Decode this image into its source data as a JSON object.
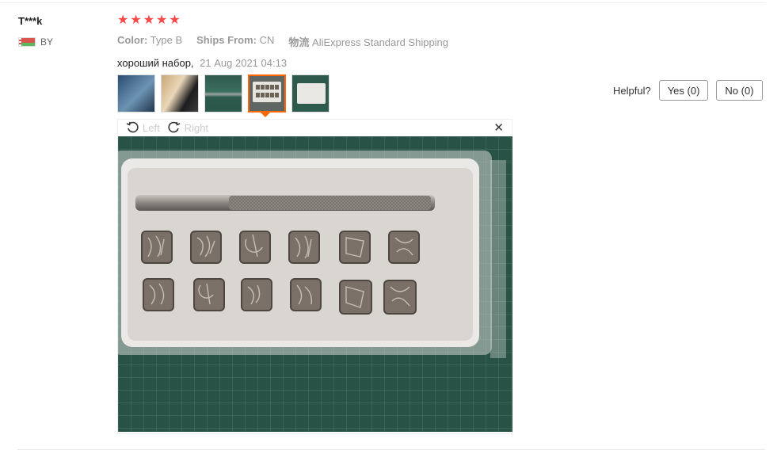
{
  "reviewer": {
    "name": "T***k",
    "country_code": "BY"
  },
  "review": {
    "rating": 5,
    "stars": [
      "★",
      "★",
      "★",
      "★",
      "★"
    ],
    "attrs": [
      {
        "label": "Color:",
        "value": "Type B"
      },
      {
        "label": "Ships From:",
        "value": "CN"
      },
      {
        "label": "物流",
        "value": "AliExpress Standard Shipping"
      }
    ],
    "comment": "хороший набор,",
    "date": "21 Aug 2021 04:13"
  },
  "thumbnails": {
    "count": 5,
    "active_index": 3
  },
  "helpful": {
    "label": "Helpful?",
    "yes": "Yes (0)",
    "no": "No (0)"
  },
  "viewer": {
    "rotate_left": "Left",
    "rotate_right": "Right",
    "close_glyph": "✕"
  },
  "colors": {
    "star": "#ff4747",
    "active_border": "#ff6600",
    "mat": "#2d5a4d"
  }
}
